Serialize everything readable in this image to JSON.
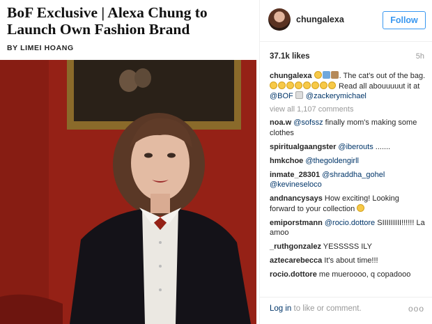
{
  "article": {
    "headline": "BoF Exclusive | Alexa Chung to Launch Own Fashion Brand",
    "byline": "BY LIMEI HOANG"
  },
  "post": {
    "username": "chungalexa",
    "follow_label": "Follow",
    "likes": "37.1k likes",
    "time": "5h",
    "caption": {
      "user": "chungalexa",
      "text_1": ". The cat's out of the bag.",
      "text_2": " Read all abouuuuut it at ",
      "mention_1": "@BOF",
      "mention_2": "@zackerymichael"
    },
    "view_all": "view all 1,107 comments",
    "comments": [
      {
        "user": "noa.w",
        "mention": "@sofssz",
        "text": " finally mom's making some clothes"
      },
      {
        "user": "spiritualgaangster",
        "mention": "@iberouts",
        "text": " ......."
      },
      {
        "user": "hmkchoe",
        "mention": "@thegoldengirll",
        "text": ""
      },
      {
        "user": "inmate_28301",
        "mention": "@shraddha_gohel",
        "mention_2": "@kevineseloco",
        "text": ""
      },
      {
        "user": "andnancysays",
        "mention": "",
        "text": " How exciting! Looking forward to your collection"
      },
      {
        "user": "emiporstmann",
        "mention": "@rocio.dottore",
        "text": " SIIIIIIIII!!!!!! La amoo"
      },
      {
        "user": "_ruthgonzalez",
        "mention": "",
        "text": " YESSSSS ILY"
      },
      {
        "user": "aztecarebecca",
        "mention": "",
        "text": " It's about time!!!"
      },
      {
        "user": "rocio.dottore",
        "mention": "",
        "text": " me mueroooo, q copadooo"
      }
    ],
    "footer": {
      "login_link": "Log in",
      "login_text": " to like or comment.",
      "more": "ooo"
    }
  }
}
